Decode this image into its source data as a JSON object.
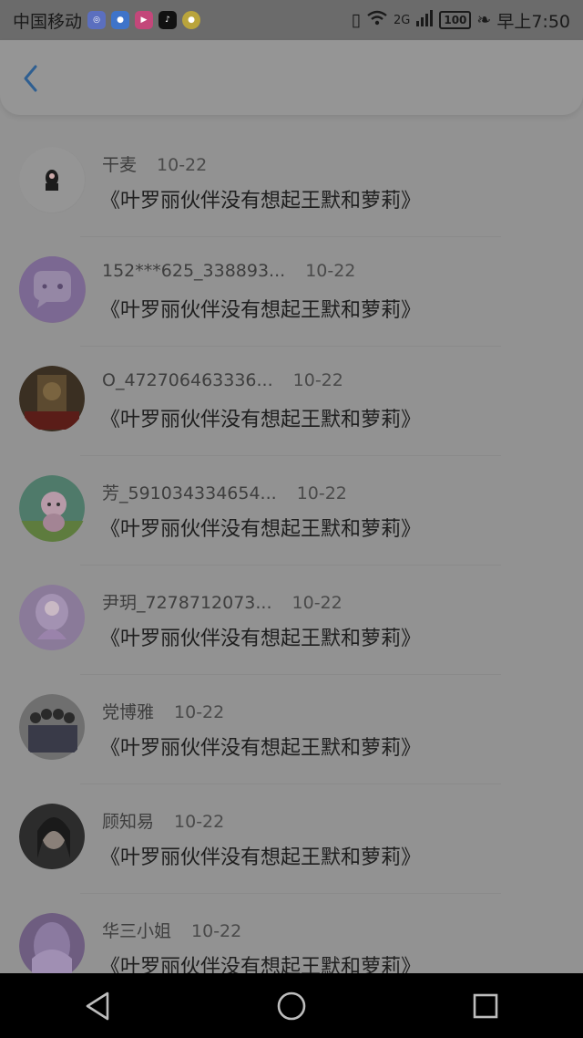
{
  "status_bar": {
    "carrier": "中国移动",
    "apps": [
      "browser-app-icon",
      "blue-app-icon",
      "video-app-icon",
      "tiktok-app-icon",
      "yellow-app-icon"
    ],
    "signal_label": "2G",
    "battery": "100",
    "time": "早上7:50"
  },
  "header": {
    "back_icon": "chevron-left-icon"
  },
  "list": {
    "items": [
      {
        "name": "干麦",
        "date": "10-22",
        "title": "《叶罗丽伙伴没有想起王默和萝莉》",
        "avatar": "avatar-small-figure"
      },
      {
        "name": "152***625_338893...",
        "date": "10-22",
        "title": "《叶罗丽伙伴没有想起王默和萝莉》",
        "avatar": "avatar-chat-bubble"
      },
      {
        "name": "O_472706463336...",
        "date": "10-22",
        "title": "《叶罗丽伙伴没有想起王默和萝莉》",
        "avatar": "avatar-photo"
      },
      {
        "name": "芳_591034334654...",
        "date": "10-22",
        "title": "《叶罗丽伙伴没有想起王默和萝莉》",
        "avatar": "avatar-cartoon"
      },
      {
        "name": "尹玥_7278712073...",
        "date": "10-22",
        "title": "《叶罗丽伙伴没有想起王默和萝莉》",
        "avatar": "avatar-doll"
      },
      {
        "name": "党博雅",
        "date": "10-22",
        "title": "《叶罗丽伙伴没有想起王默和萝莉》",
        "avatar": "avatar-group"
      },
      {
        "name": "顾知易",
        "date": "10-22",
        "title": "《叶罗丽伙伴没有想起王默和萝莉》",
        "avatar": "avatar-portrait"
      },
      {
        "name": "华三小姐",
        "date": "10-22",
        "title": "《叶罗丽伙伴没有想起王默和萝莉》",
        "avatar": "avatar-purple"
      }
    ]
  },
  "nav_bar": {
    "back": "triangle-back-icon",
    "home": "circle-home-icon",
    "recents": "square-recents-icon"
  }
}
